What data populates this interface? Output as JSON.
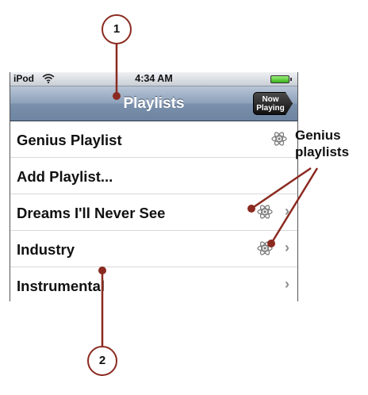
{
  "status_bar": {
    "carrier": "iPod",
    "time": "4:34 AM"
  },
  "nav": {
    "title": "Playlists",
    "now_playing_line1": "Now",
    "now_playing_line2": "Playing"
  },
  "playlists": [
    {
      "label": "Genius Playlist",
      "genius": true,
      "chevron": false
    },
    {
      "label": "Add Playlist...",
      "genius": false,
      "chevron": false
    },
    {
      "label": "Dreams I'll Never See",
      "genius": true,
      "chevron": true
    },
    {
      "label": "Industry",
      "genius": true,
      "chevron": true
    },
    {
      "label": "Instrumental",
      "genius": false,
      "chevron": true
    }
  ],
  "annotations": {
    "callout_1": "1",
    "callout_2": "2",
    "genius_label_line1": "Genius",
    "genius_label_line2": "playlists"
  },
  "icons": {
    "wifi": "wifi-icon",
    "genius": "genius-atom-icon",
    "chevron": "chevron-right-icon",
    "battery": "battery-icon"
  },
  "colors": {
    "callout_red": "#8b2a20",
    "nav_blue": "#7a90ab"
  }
}
